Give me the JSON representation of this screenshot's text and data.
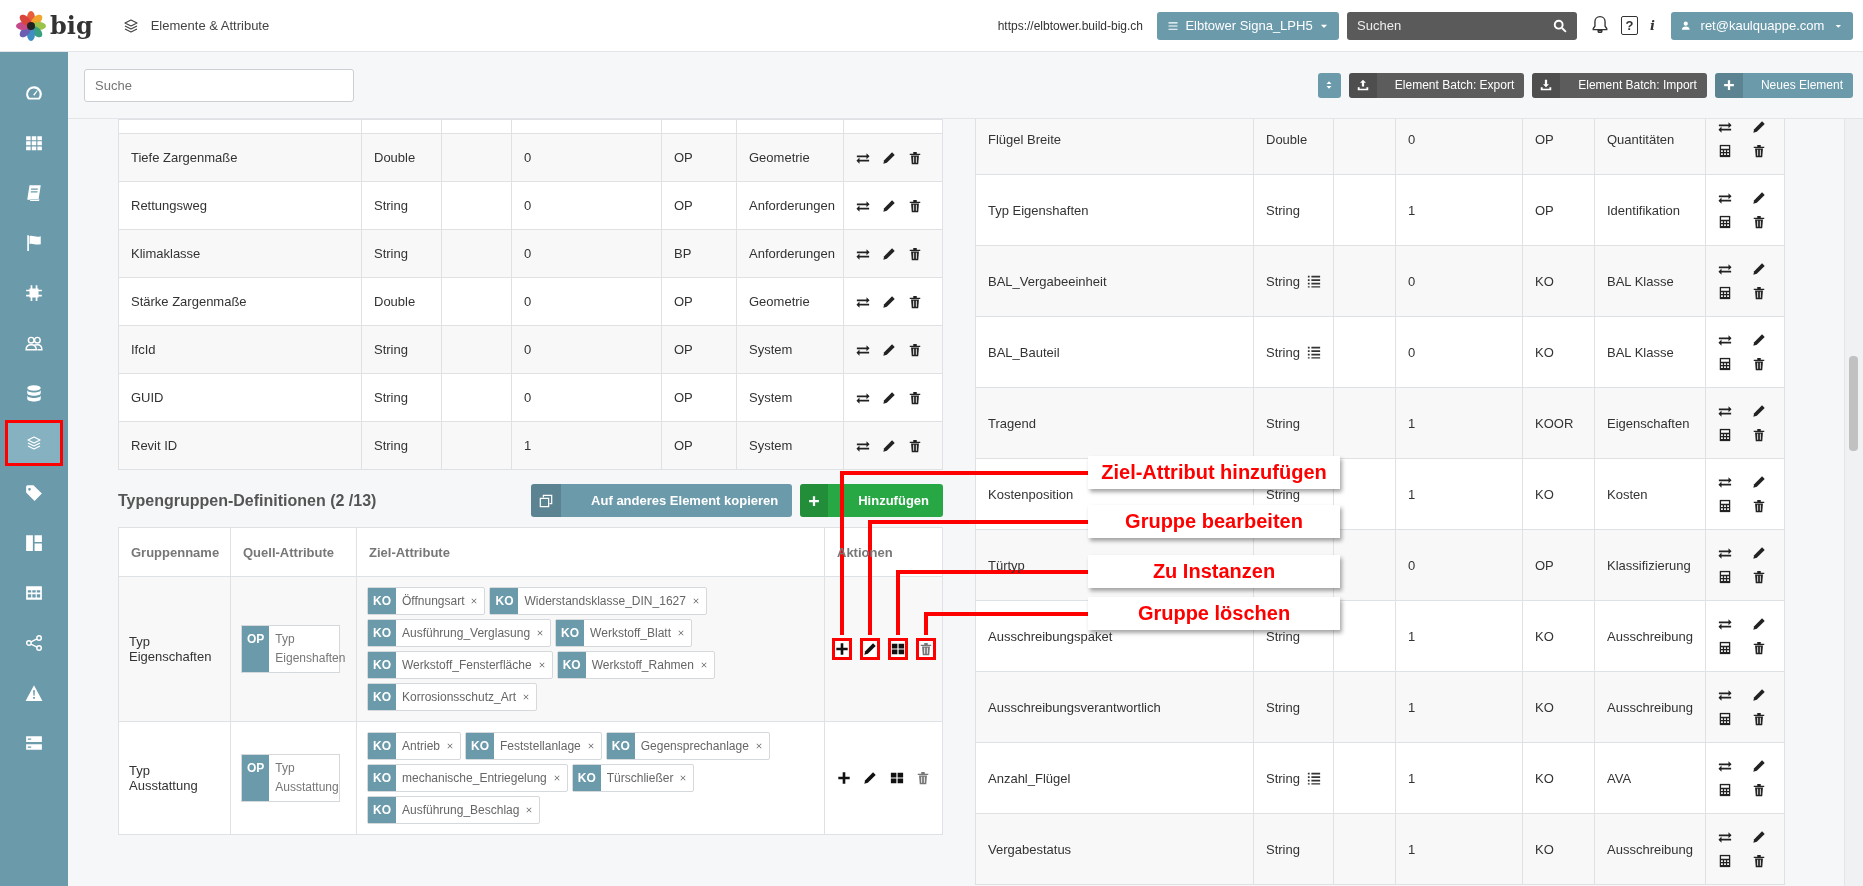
{
  "header": {
    "logo": "big",
    "page_title": "Elemente & Attribute",
    "url": "https://elbtower.build-big.ch",
    "project": "Elbtower Signa_LPH5",
    "search": {
      "placeholder": "Suchen"
    },
    "help": "?",
    "info": "i",
    "user": "ret@kaulquappe.com"
  },
  "sidebar": {
    "items": [
      {
        "selected": false
      },
      {
        "selected": false
      },
      {
        "selected": false
      },
      {
        "selected": false
      },
      {
        "selected": false
      },
      {
        "selected": false
      },
      {
        "selected": false
      },
      {
        "selected": true
      },
      {
        "selected": false
      },
      {
        "selected": false
      },
      {
        "selected": false
      },
      {
        "selected": false
      },
      {
        "selected": false
      },
      {
        "selected": false
      }
    ]
  },
  "toolbar": {
    "search": {
      "placeholder": "Suche"
    },
    "buttons": [
      {
        "kind": "sort"
      },
      {
        "kind": "export",
        "label": "Element Batch: Export"
      },
      {
        "kind": "import",
        "label": "Element Batch: Import"
      },
      {
        "kind": "new",
        "label": "Neues Element"
      }
    ]
  },
  "attributes_left": {
    "rows": [
      {
        "name": "Tiefe Zargenmaße",
        "type": "Double",
        "list": false,
        "column_4": "0",
        "column_5": "OP",
        "column_6": "Geometrie"
      },
      {
        "name": "Rettungsweg",
        "type": "String",
        "list": false,
        "column_4": "0",
        "column_5": "OP",
        "column_6": "Anforderungen"
      },
      {
        "name": "Klimaklasse",
        "type": "String",
        "list": false,
        "column_4": "0",
        "column_5": "BP",
        "column_6": "Anforderungen"
      },
      {
        "name": "Stärke Zargenmaße",
        "type": "Double",
        "list": false,
        "column_4": "0",
        "column_5": "OP",
        "column_6": "Geometrie"
      },
      {
        "name": "IfcId",
        "type": "String",
        "list": false,
        "column_4": "0",
        "column_5": "OP",
        "column_6": "System"
      },
      {
        "name": "GUID",
        "type": "String",
        "list": false,
        "column_4": "0",
        "column_5": "OP",
        "column_6": "System"
      },
      {
        "name": "Revit ID",
        "type": "String",
        "list": false,
        "column_4": "1",
        "column_5": "OP",
        "column_6": "System"
      }
    ]
  },
  "type_groups": {
    "title": "Typengruppen-Definitionen (2 /13)",
    "buttons": [
      {
        "kind": "copy",
        "label": "Auf anderes Element kopieren"
      },
      {
        "kind": "add",
        "label": "Hinzufügen"
      }
    ],
    "columns": [
      "Gruppenname",
      "Quell-Attribute",
      "Ziel-Attribute",
      "Aktionen"
    ],
    "rows": [
      {
        "name": "Typ Eigenschaften",
        "highlighted": true,
        "source": {
          "level": "OP",
          "name": "Typ Eigenshaften"
        },
        "targets": [
          {
            "level": "KO",
            "name": "Öffnungsart"
          },
          {
            "level": "KO",
            "name": "Widerstandsklasse_DIN_1627"
          },
          {
            "level": "KO",
            "name": "Ausführung_Verglasung"
          },
          {
            "level": "KO",
            "name": "Werkstoff_Blatt"
          },
          {
            "level": "KO",
            "name": "Werkstoff_Fensterfläche"
          },
          {
            "level": "KO",
            "name": "Werkstoff_Rahmen"
          },
          {
            "level": "KO",
            "name": "Korrosionsschutz_Art"
          }
        ]
      },
      {
        "name": "Typ Ausstattung",
        "highlighted": false,
        "source": {
          "level": "OP",
          "name": "Typ Ausstattung"
        },
        "targets": [
          {
            "level": "KO",
            "name": "Antrieb"
          },
          {
            "level": "KO",
            "name": "Feststellanlage"
          },
          {
            "level": "KO",
            "name": "Gegensprechanlage"
          },
          {
            "level": "KO",
            "name": "mechanische_Entriegelung"
          },
          {
            "level": "KO",
            "name": "Türschließer"
          },
          {
            "level": "KO",
            "name": "Ausführung_Beschlag"
          }
        ]
      }
    ]
  },
  "attributes_right": {
    "rows": [
      {
        "name": "Flügel Breite",
        "type": "Double",
        "list": false,
        "column_4": "0",
        "column_5": "OP",
        "column_6": "Quantitäten"
      },
      {
        "name": "Typ Eigenshaften",
        "type": "String",
        "list": false,
        "column_4": "1",
        "column_5": "OP",
        "column_6": "Identifikation"
      },
      {
        "name": "BAL_Vergabeeinheit",
        "type": "String",
        "list": true,
        "column_4": "0",
        "column_5": "KO",
        "column_6": "BAL Klasse"
      },
      {
        "name": "BAL_Bauteil",
        "type": "String",
        "list": true,
        "column_4": "0",
        "column_5": "KO",
        "column_6": "BAL Klasse"
      },
      {
        "name": "Tragend",
        "type": "String",
        "list": false,
        "column_4": "1",
        "column_5": "KOOR",
        "column_6": "Eigenschaften"
      },
      {
        "name": "Kostenposition",
        "type": "String",
        "list": false,
        "column_4": "1",
        "column_5": "KO",
        "column_6": "Kosten"
      },
      {
        "name": "Türtyp",
        "column_4": "0",
        "column_5": "OP",
        "column_6": "Klassifizierung"
      },
      {
        "name": "Ausschreibungspaket",
        "type": "String",
        "list": false,
        "column_4": "1",
        "column_5": "KO",
        "column_6": "Ausschreibung"
      },
      {
        "name": "Ausschreibungsverantwortlich",
        "type": "String",
        "list": false,
        "column_4": "1",
        "column_5": "KO",
        "column_6": "Ausschreibung"
      },
      {
        "name": "Anzahl_Flügel",
        "type": "String",
        "list": true,
        "column_4": "1",
        "column_5": "KO",
        "column_6": "AVA"
      },
      {
        "name": "Vergabestatus",
        "type": "String",
        "list": false,
        "column_4": "1",
        "column_5": "KO",
        "column_6": "Ausschreibung"
      }
    ]
  },
  "callouts": [
    {
      "text": "Ziel-Attribut hinzufügen"
    },
    {
      "text": "Gruppe bearbeiten"
    },
    {
      "text": "Zu Instanzen"
    },
    {
      "text": "Gruppe löschen"
    }
  ]
}
